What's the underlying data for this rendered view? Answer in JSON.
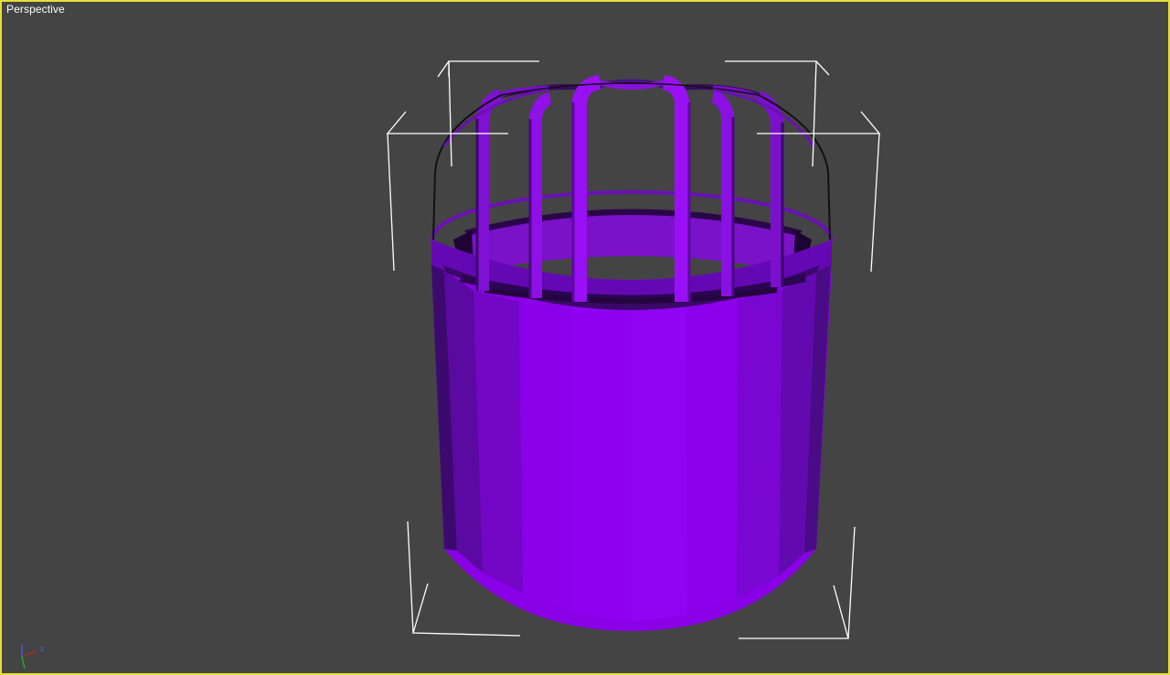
{
  "viewport": {
    "label": "Perspective",
    "border_color": "#e6dd3c",
    "background_color": "#444444"
  },
  "object": {
    "color": "#9000f0",
    "shape": "cylinder-with-cage-top"
  },
  "axis_gizmo": {
    "x_color": "#d02020",
    "y_color": "#20c020",
    "z_color": "#4060ff",
    "z_label": "z"
  }
}
